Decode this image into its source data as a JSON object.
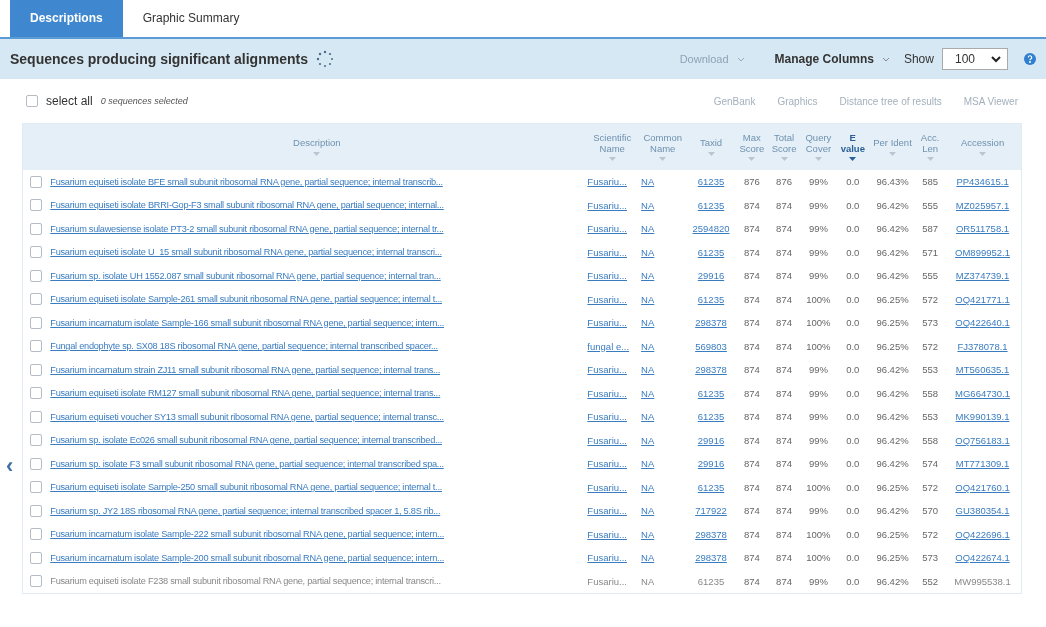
{
  "tabs": [
    {
      "label": "Descriptions",
      "selected": true
    },
    {
      "label": "Graphic Summary",
      "selected": false
    }
  ],
  "header": {
    "title": "Sequences producing significant alignments",
    "download": {
      "label": "Download",
      "disabled": true
    },
    "manage_columns": "Manage Columns",
    "show_label": "Show",
    "show_value": "100"
  },
  "select_all": {
    "label": "select all",
    "checked": false,
    "count": "0 sequences selected"
  },
  "actions": [
    {
      "label": "GenBank",
      "disabled": true
    },
    {
      "label": "Graphics",
      "disabled": true
    },
    {
      "label": "Distance tree of results",
      "disabled": true
    },
    {
      "label": "MSA Viewer",
      "disabled": true
    }
  ],
  "table": {
    "columns": [
      {
        "label": "Description",
        "sorted": false
      },
      {
        "label": "Scientific Name",
        "sorted": false
      },
      {
        "label": "Common Name",
        "sorted": false
      },
      {
        "label": "Taxid",
        "sorted": false
      },
      {
        "label": "Max Score",
        "sorted": false
      },
      {
        "label": "Total Score",
        "sorted": false
      },
      {
        "label": "Query Cover",
        "sorted": false
      },
      {
        "label": "E value",
        "sorted": true
      },
      {
        "label": "Per Ident",
        "sorted": false
      },
      {
        "label": "Acc. Len",
        "sorted": false
      },
      {
        "label": "Accession",
        "sorted": false
      }
    ],
    "rows": [
      {
        "checked": false,
        "linked": true,
        "cells": [
          "Fusarium equiseti isolate BFE small subunit ribosomal RNA gene, partial sequence; internal transcrib...",
          "Fusariu...",
          "NA",
          "61235",
          "876",
          "876",
          "99%",
          "0.0",
          "96.43%",
          "585",
          "PP434615.1"
        ]
      },
      {
        "checked": false,
        "linked": true,
        "cells": [
          "Fusarium equiseti isolate BRRI-Gop-F3 small subunit ribosomal RNA gene, partial sequence; internal...",
          "Fusariu...",
          "NA",
          "61235",
          "874",
          "874",
          "99%",
          "0.0",
          "96.42%",
          "555",
          "MZ025957.1"
        ]
      },
      {
        "checked": false,
        "linked": true,
        "cells": [
          "Fusarium sulawesiense isolate PT3-2 small subunit ribosomal RNA gene, partial sequence; internal tr...",
          "Fusariu...",
          "NA",
          "2594820",
          "874",
          "874",
          "99%",
          "0.0",
          "96.42%",
          "587",
          "OR511758.1"
        ]
      },
      {
        "checked": false,
        "linked": true,
        "cells": [
          "Fusarium equiseti isolate U_15 small subunit ribosomal RNA gene, partial sequence; internal transcri...",
          "Fusariu...",
          "NA",
          "61235",
          "874",
          "874",
          "99%",
          "0.0",
          "96.42%",
          "571",
          "OM899952.1"
        ]
      },
      {
        "checked": false,
        "linked": true,
        "cells": [
          "Fusarium sp. isolate UH 1552.087 small subunit ribosomal RNA gene, partial sequence; internal tran...",
          "Fusariu...",
          "NA",
          "29916",
          "874",
          "874",
          "99%",
          "0.0",
          "96.42%",
          "555",
          "MZ374739.1"
        ]
      },
      {
        "checked": false,
        "linked": true,
        "cells": [
          "Fusarium equiseti isolate Sample-261 small subunit ribosomal RNA gene, partial sequence; internal t...",
          "Fusariu...",
          "NA",
          "61235",
          "874",
          "874",
          "100%",
          "0.0",
          "96.25%",
          "572",
          "OQ421771.1"
        ]
      },
      {
        "checked": false,
        "linked": true,
        "cells": [
          "Fusarium incarnatum isolate Sample-166 small subunit ribosomal RNA gene, partial sequence; intern...",
          "Fusariu...",
          "NA",
          "298378",
          "874",
          "874",
          "100%",
          "0.0",
          "96.25%",
          "573",
          "OQ422640.1"
        ]
      },
      {
        "checked": false,
        "linked": true,
        "cells": [
          "Fungal endophyte sp. SX08 18S ribosomal RNA gene, partial sequence; internal transcribed spacer...",
          "fungal e...",
          "NA",
          "569803",
          "874",
          "874",
          "100%",
          "0.0",
          "96.25%",
          "572",
          "FJ378078.1"
        ]
      },
      {
        "checked": false,
        "linked": true,
        "cells": [
          "Fusarium incarnatum strain ZJ11 small subunit ribosomal RNA gene, partial sequence; internal trans...",
          "Fusariu...",
          "NA",
          "298378",
          "874",
          "874",
          "99%",
          "0.0",
          "96.42%",
          "553",
          "MT560635.1"
        ]
      },
      {
        "checked": false,
        "linked": true,
        "cells": [
          "Fusarium equiseti isolate RM127 small subunit ribosomal RNA gene, partial sequence; internal trans...",
          "Fusariu...",
          "NA",
          "61235",
          "874",
          "874",
          "99%",
          "0.0",
          "96.42%",
          "558",
          "MG664730.1"
        ]
      },
      {
        "checked": false,
        "linked": true,
        "cells": [
          "Fusarium equiseti voucher SY13 small subunit ribosomal RNA gene, partial sequence; internal transc...",
          "Fusariu...",
          "NA",
          "61235",
          "874",
          "874",
          "99%",
          "0.0",
          "96.42%",
          "553",
          "MK990139.1"
        ]
      },
      {
        "checked": false,
        "linked": true,
        "cells": [
          "Fusarium sp. isolate Ec026 small subunit ribosomal RNA gene, partial sequence; internal transcribed...",
          "Fusariu...",
          "NA",
          "29916",
          "874",
          "874",
          "99%",
          "0.0",
          "96.42%",
          "558",
          "OQ756183.1"
        ]
      },
      {
        "checked": false,
        "linked": true,
        "cells": [
          "Fusarium sp. isolate F3 small subunit ribosomal RNA gene, partial sequence; internal transcribed spa...",
          "Fusariu...",
          "NA",
          "29916",
          "874",
          "874",
          "99%",
          "0.0",
          "96.42%",
          "574",
          "MT771309.1"
        ]
      },
      {
        "checked": false,
        "linked": true,
        "cells": [
          "Fusarium equiseti isolate Sample-250 small subunit ribosomal RNA gene, partial sequence; internal t...",
          "Fusariu...",
          "NA",
          "61235",
          "874",
          "874",
          "100%",
          "0.0",
          "96.25%",
          "572",
          "OQ421760.1"
        ]
      },
      {
        "checked": false,
        "linked": true,
        "cells": [
          "Fusarium sp. JY2 18S ribosomal RNA gene, partial sequence; internal transcribed spacer 1, 5.8S rib...",
          "Fusariu...",
          "NA",
          "717922",
          "874",
          "874",
          "99%",
          "0.0",
          "96.42%",
          "570",
          "GU380354.1"
        ]
      },
      {
        "checked": false,
        "linked": true,
        "cells": [
          "Fusarium incarnatum isolate Sample-222 small subunit ribosomal RNA gene, partial sequence; intern...",
          "Fusariu...",
          "NA",
          "298378",
          "874",
          "874",
          "100%",
          "0.0",
          "96.25%",
          "572",
          "OQ422696.1"
        ]
      },
      {
        "checked": false,
        "linked": true,
        "cells": [
          "Fusarium incarnatum isolate Sample-200 small subunit ribosomal RNA gene, partial sequence; intern...",
          "Fusariu...",
          "NA",
          "298378",
          "874",
          "874",
          "100%",
          "0.0",
          "96.25%",
          "573",
          "OQ422674.1"
        ]
      },
      {
        "checked": false,
        "linked": false,
        "cells": [
          "Fusarium equiseti isolate F238 small subunit ribosomal RNA gene, partial sequence; internal transcri...",
          "Fusariu...",
          "NA",
          "61235",
          "874",
          "874",
          "99%",
          "0.0",
          "96.42%",
          "552",
          "MW995538.1"
        ]
      }
    ]
  },
  "side_arrow": "‹"
}
